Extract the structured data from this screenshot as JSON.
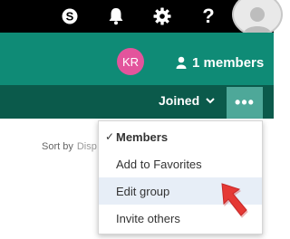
{
  "topbar": {
    "icons": [
      "skype-icon",
      "bell-icon",
      "gear-icon",
      "help-icon",
      "user-avatar-icon"
    ],
    "help_label": "?"
  },
  "group": {
    "owner_initials": "KR",
    "members_label": "1 members"
  },
  "nav": {
    "joined_label": "Joined",
    "more_label": "•••"
  },
  "content": {
    "sort_label": "Sort by",
    "sort_value": "Disp"
  },
  "menu": {
    "items": [
      {
        "label": "Members",
        "checked": true
      },
      {
        "label": "Add to Favorites"
      },
      {
        "label": "Edit group",
        "highlighted": true
      },
      {
        "label": "Invite others"
      }
    ]
  },
  "colors": {
    "topbar": "#000000",
    "banner": "#0f8b76",
    "navbar": "#0b5a4b",
    "more_button": "#4ea899",
    "avatar": "#e3549c",
    "highlight": "#e7eef7",
    "pointer": "#e53935"
  }
}
